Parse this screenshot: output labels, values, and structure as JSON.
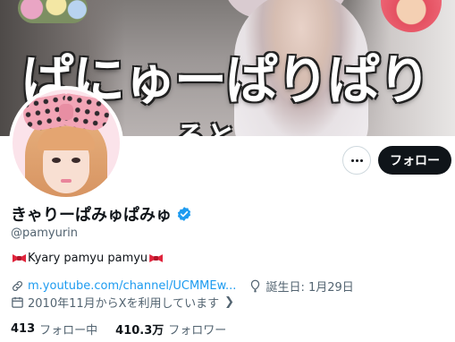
{
  "banner": {
    "caption": "ぱにゅーぱりぱり",
    "subcaption": "ると"
  },
  "actions": {
    "more_label": "",
    "follow_label": "フォロー"
  },
  "profile": {
    "display_name": "きゃりーぱみゅぱみゅ",
    "handle": "@pamyurin",
    "bio": "Kyary pamyu pamyu",
    "website": "m.youtube.com/channel/UCMMEw...",
    "birthday": "誕生日: 1月29日",
    "joined": "2010年11月からXを利用しています"
  },
  "stats": {
    "following_count": "413",
    "following_label": "フォロー中",
    "followers_count": "410.3万",
    "followers_label": "フォロワー"
  },
  "colors": {
    "accent": "#1d9bf0",
    "text": "#0f1419",
    "muted": "#536471",
    "follow_button": "#0f1419"
  },
  "icons": [
    "verified-badge-icon",
    "link-icon",
    "birthday-balloon-icon",
    "calendar-icon",
    "more-dots-icon",
    "ribbon-emoji"
  ]
}
